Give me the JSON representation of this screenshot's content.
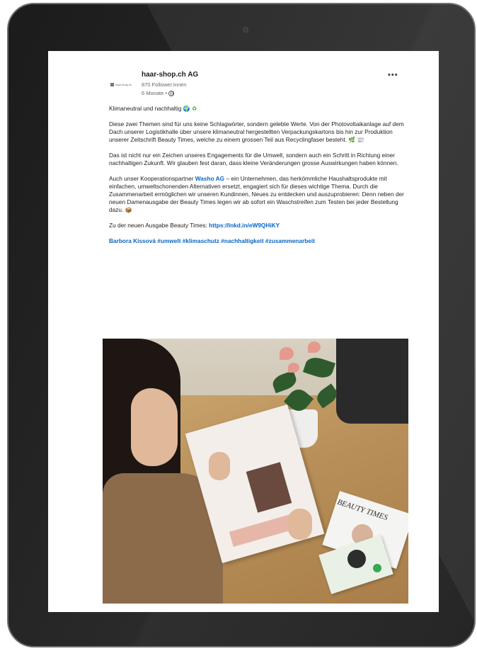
{
  "post": {
    "author": {
      "name": "haar-shop.ch AG",
      "logo_text": "haar-shop.ch",
      "followers": "870 Follower:innen",
      "time": "6 Monate •"
    },
    "more_label": "•••",
    "headline": "Klimaneutral und nachhaltig",
    "paragraphs": [
      "Diese zwei Themen sind für uns keine Schlagwörter, sondern gelebte Werte. Von der Photovoltaikanlage auf dem Dach unserer Logistikhalle über unsere klimaneutral hergestellten Verpackungskartons bis hin zur Produktion unserer Zeitschrift Beauty Times, welche zu einem grossen Teil aus Recyclingfaser besteht.",
      "Das ist nicht nur ein Zeichen unseres Engagements für die Umwelt, sondern auch ein Schritt in Richtung einer nachhaltigen Zukunft. Wir glauben fest daran, dass kleine Veränderungen grosse Auswirkungen haben können."
    ],
    "partner_intro": "Auch unser Kooperationspartner",
    "partner_name": "Washo AG",
    "partner_text": "– ein Unternehmen, das herkömmliche Haushaltsprodukte mit einfachen, umweltschonenden Alternativen ersetzt, engagiert sich für dieses wichtige Thema. Durch die Zusammenarbeit ermöglichen wir unseren Kundinnen, Neues zu entdecken und auszuprobieren: Denn neben der neuen Damenausgabe der Beauty Times legen wir ab sofort ein Waschstreifen zum Testen bei jeder Bestellung dazu.",
    "link_intro": "Zu der neuen Ausgabe Beauty Times:",
    "link_url": "https://lnkd.in/eW9QHiKY",
    "mention": "Barbora Kissová",
    "hashtags": "#umwelt #klimaschutz #nachhaltigkeit #zusammenarbeit",
    "emojis": {
      "globe": "🌍",
      "recycle": "♻",
      "leaf": "🌿",
      "newspaper": "📰",
      "box": "📦"
    },
    "photo": {
      "magazine_title": "BEAUTY TIMES"
    }
  },
  "colors": {
    "link": "#0a66c2",
    "bezel": "#1b1b1b"
  }
}
